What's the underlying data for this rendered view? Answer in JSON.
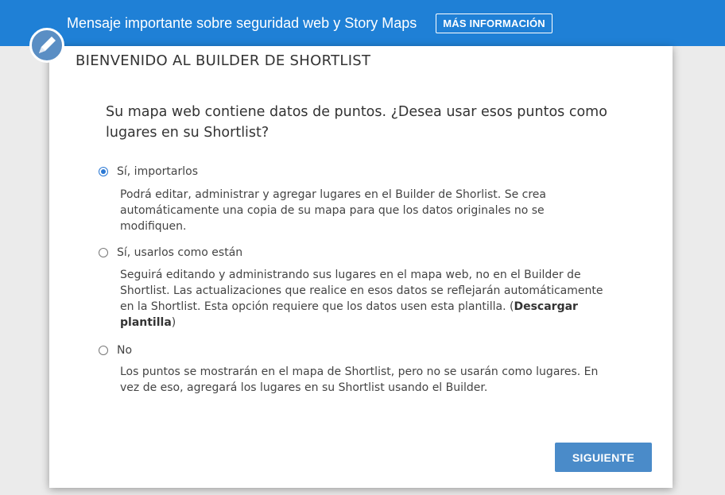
{
  "banner": {
    "message": "Mensaje importante sobre seguridad web y Story Maps",
    "more_info_label": "MÁS INFORMACIÓN",
    "color": "#1f80d6"
  },
  "dialog": {
    "icon": "pencil-icon",
    "title": "BIENVENIDO AL BUILDER DE SHORTLIST",
    "question": "Su mapa web contiene datos de puntos. ¿Desea usar esos puntos como lugares en su Shortlist?",
    "options": [
      {
        "label": "Sí, importarlos",
        "selected": true,
        "description": "Podrá editar, administrar y agregar lugares en el Builder de Shorlist. Se crea automáticamente una copia de su mapa para que los datos originales no se modifiquen."
      },
      {
        "label": "Sí, usarlos como están",
        "selected": false,
        "description": "Seguirá editando y administrando sus lugares en el mapa web, no en el Builder de Shortlist. Las actualizaciones que realice en esos datos se reflejarán automáticamente en la Shortlist. Esta opción requiere que los datos usen esta plantilla. (",
        "link_label": "Descargar plantilla",
        "description_end": ")"
      },
      {
        "label": "No",
        "selected": false,
        "description": "Los puntos se mostrarán en el mapa de Shortlist, pero no se usarán como lugares. En vez de eso, agregará los lugares en su Shortlist usando el Builder."
      }
    ],
    "next_label": "SIGUIENTE",
    "accent_color": "#4a8bc9"
  }
}
